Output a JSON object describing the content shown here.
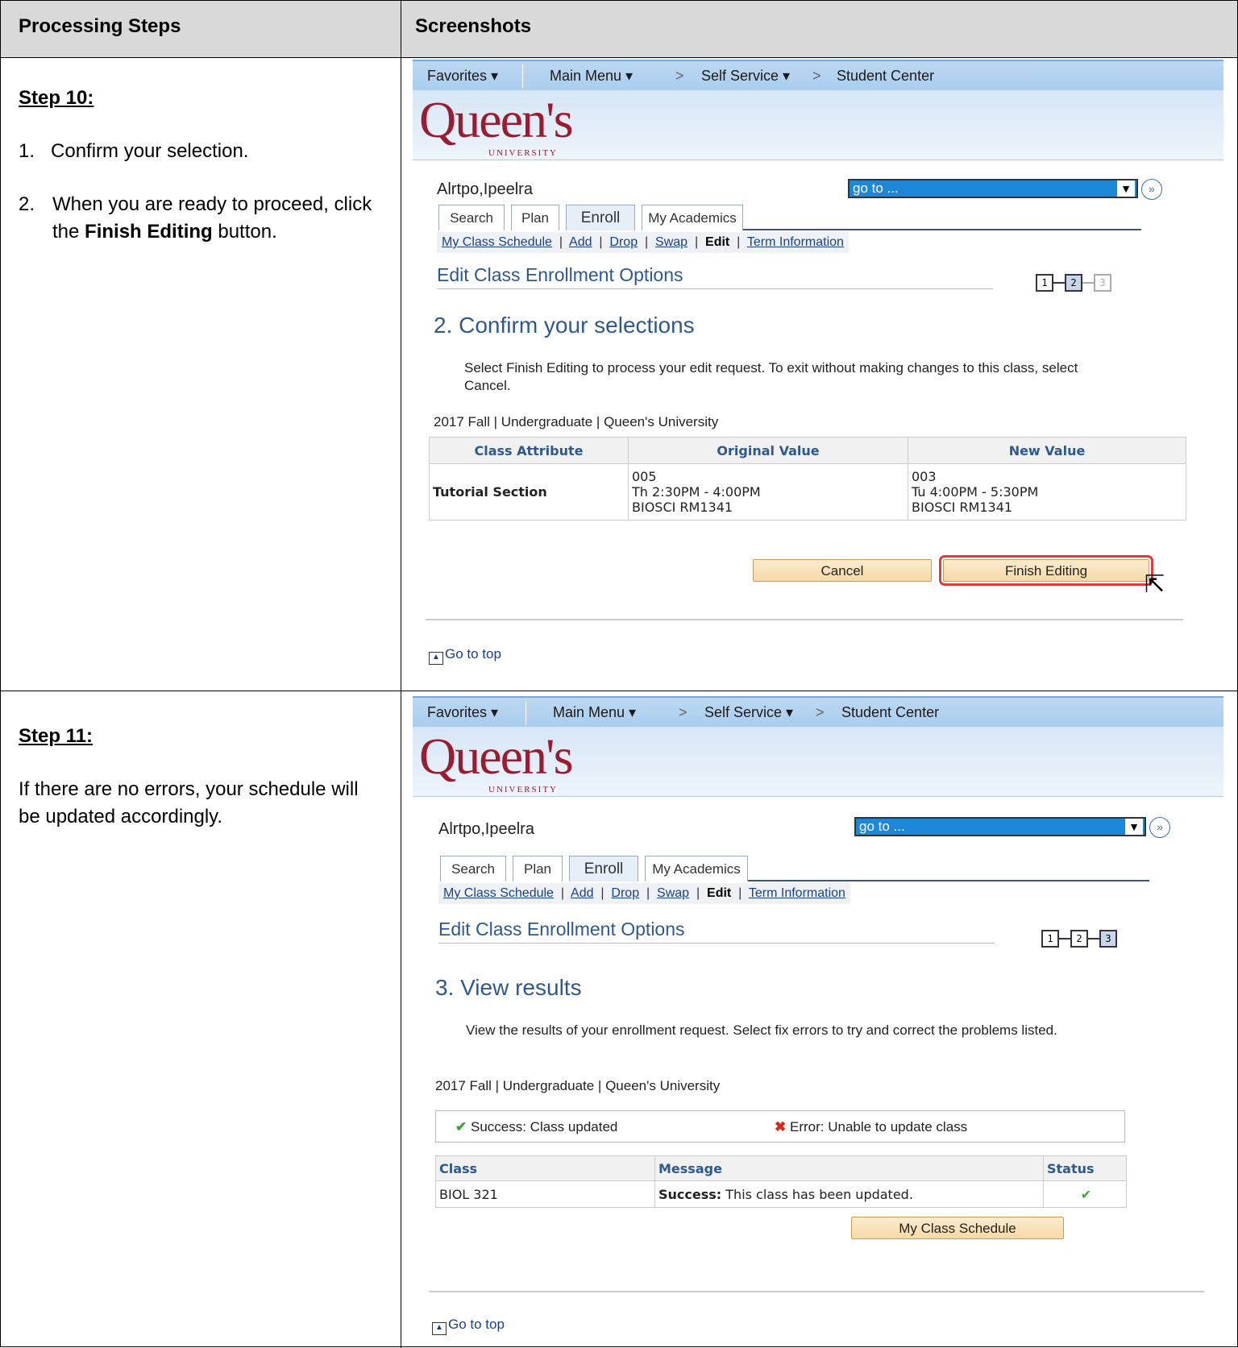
{
  "header": {
    "col1": "Processing Steps",
    "col2": "Screenshots"
  },
  "step10": {
    "title": "Step 10:",
    "item1": "Confirm your selection.",
    "item2_pre": "When you are ready to proceed, click the ",
    "item2_bold": "Finish Editing",
    "item2_post": " button."
  },
  "step11": {
    "title": "Step 11:",
    "text": "If there are no errors, your schedule will be updated accordingly."
  },
  "nav": {
    "favorites": "Favorites ▾",
    "main_menu": "Main Menu ▾",
    "crumb_sep": ">",
    "self_service": "Self Service ▾",
    "student_center": "Student Center",
    "logo": "Queen's",
    "logo_sub": "UNIVERSITY",
    "user_name": "Alrtpo,Ipeelra",
    "goto_value": "go to ...",
    "tabs": [
      "Search",
      "Plan",
      "Enroll",
      "My Academics"
    ],
    "subnav": {
      "my_class_schedule": "My Class Schedule",
      "add": "Add",
      "drop": "Drop",
      "swap": "Swap",
      "edit": "Edit",
      "term_information": "Term Information",
      "sep": "|"
    },
    "page_heading": "Edit Class Enrollment Options",
    "steps": [
      "1",
      "2",
      "3"
    ],
    "go_to_top": "Go to top",
    "term": "2017 Fall | Undergraduate | Queen's University"
  },
  "shot1": {
    "heading": "2.  Confirm your selections",
    "description": "Select Finish Editing to process your edit request.  To exit without making changes to this class, select Cancel.",
    "table_headers": [
      "Class Attribute",
      "Original Value",
      "New Value"
    ],
    "row": {
      "attribute": "Tutorial Section",
      "original": [
        "005",
        "Th 2:30PM - 4:00PM",
        "BIOSCI RM1341"
      ],
      "new": [
        "003",
        "Tu 4:00PM - 5:30PM",
        "BIOSCI RM1341"
      ]
    },
    "cancel_label": "Cancel",
    "finish_label": "Finish Editing"
  },
  "shot2": {
    "heading": "3.  View results",
    "description": "View the results of your enrollment request.  Select fix errors to try and correct the problems listed.",
    "legend_success": "Success:  Class updated",
    "legend_error": "Error: Unable to update class",
    "table_headers": [
      "Class",
      "Message",
      "Status"
    ],
    "row": {
      "class": "BIOL  321",
      "message_bold": "Success:",
      "message": " This class has been updated.",
      "status": "✔"
    },
    "schedule_button": "My Class Schedule"
  },
  "colors": {
    "accent_blue": "#2e5890",
    "brand_red": "#9b1b30",
    "highlight_red": "#e23a3a"
  }
}
